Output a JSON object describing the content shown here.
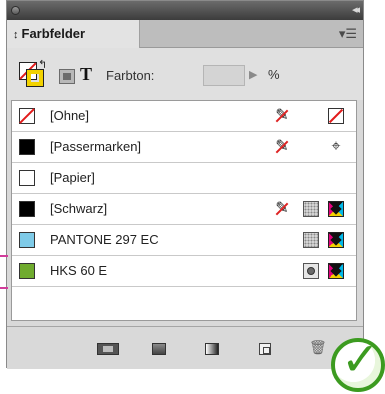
{
  "panel": {
    "title_tab": "Farbfelder",
    "tab_arrows": "↕",
    "menu_icon": "panel-menu-icon",
    "collapse_glyph": "◂◂"
  },
  "toolbar": {
    "tint_label": "Farbton:",
    "tint_value": "",
    "tint_unit": "%",
    "text_button": "T"
  },
  "swatches": [
    {
      "name": "[Ohne]",
      "color": "none",
      "icons": [
        "no-edit-icon",
        "none-swatch-icon"
      ]
    },
    {
      "name": "[Passermarken]",
      "color": "#000000",
      "icons": [
        "no-edit-icon",
        "registration-icon"
      ]
    },
    {
      "name": "[Papier]",
      "color": "#ffffff",
      "icons": []
    },
    {
      "name": "[Schwarz]",
      "color": "#000000",
      "icons": [
        "no-edit-icon",
        "process-color-icon",
        "cmyk-icon"
      ]
    },
    {
      "name": "PANTONE 297 EC",
      "color": "#7fcbe8",
      "icons": [
        "process-color-icon",
        "cmyk-icon"
      ]
    },
    {
      "name": "HKS 60 E",
      "color": "#6fab2e",
      "icons": [
        "spot-color-icon",
        "cmyk-icon"
      ]
    }
  ],
  "colors": {
    "accent_check": "#3c9b20",
    "marker": "#d23c9b"
  }
}
